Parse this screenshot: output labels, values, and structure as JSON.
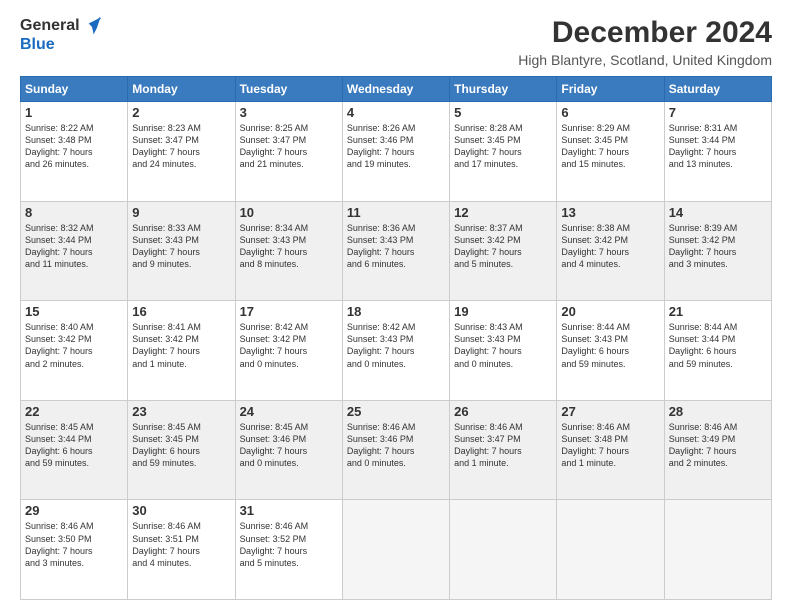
{
  "header": {
    "logo_general": "General",
    "logo_blue": "Blue",
    "title": "December 2024",
    "location": "High Blantyre, Scotland, United Kingdom"
  },
  "columns": [
    "Sunday",
    "Monday",
    "Tuesday",
    "Wednesday",
    "Thursday",
    "Friday",
    "Saturday"
  ],
  "weeks": [
    [
      {
        "day": "1",
        "info": "Sunrise: 8:22 AM\nSunset: 3:48 PM\nDaylight: 7 hours\nand 26 minutes."
      },
      {
        "day": "2",
        "info": "Sunrise: 8:23 AM\nSunset: 3:47 PM\nDaylight: 7 hours\nand 24 minutes."
      },
      {
        "day": "3",
        "info": "Sunrise: 8:25 AM\nSunset: 3:47 PM\nDaylight: 7 hours\nand 21 minutes."
      },
      {
        "day": "4",
        "info": "Sunrise: 8:26 AM\nSunset: 3:46 PM\nDaylight: 7 hours\nand 19 minutes."
      },
      {
        "day": "5",
        "info": "Sunrise: 8:28 AM\nSunset: 3:45 PM\nDaylight: 7 hours\nand 17 minutes."
      },
      {
        "day": "6",
        "info": "Sunrise: 8:29 AM\nSunset: 3:45 PM\nDaylight: 7 hours\nand 15 minutes."
      },
      {
        "day": "7",
        "info": "Sunrise: 8:31 AM\nSunset: 3:44 PM\nDaylight: 7 hours\nand 13 minutes."
      }
    ],
    [
      {
        "day": "8",
        "info": "Sunrise: 8:32 AM\nSunset: 3:44 PM\nDaylight: 7 hours\nand 11 minutes."
      },
      {
        "day": "9",
        "info": "Sunrise: 8:33 AM\nSunset: 3:43 PM\nDaylight: 7 hours\nand 9 minutes."
      },
      {
        "day": "10",
        "info": "Sunrise: 8:34 AM\nSunset: 3:43 PM\nDaylight: 7 hours\nand 8 minutes."
      },
      {
        "day": "11",
        "info": "Sunrise: 8:36 AM\nSunset: 3:43 PM\nDaylight: 7 hours\nand 6 minutes."
      },
      {
        "day": "12",
        "info": "Sunrise: 8:37 AM\nSunset: 3:42 PM\nDaylight: 7 hours\nand 5 minutes."
      },
      {
        "day": "13",
        "info": "Sunrise: 8:38 AM\nSunset: 3:42 PM\nDaylight: 7 hours\nand 4 minutes."
      },
      {
        "day": "14",
        "info": "Sunrise: 8:39 AM\nSunset: 3:42 PM\nDaylight: 7 hours\nand 3 minutes."
      }
    ],
    [
      {
        "day": "15",
        "info": "Sunrise: 8:40 AM\nSunset: 3:42 PM\nDaylight: 7 hours\nand 2 minutes."
      },
      {
        "day": "16",
        "info": "Sunrise: 8:41 AM\nSunset: 3:42 PM\nDaylight: 7 hours\nand 1 minute."
      },
      {
        "day": "17",
        "info": "Sunrise: 8:42 AM\nSunset: 3:42 PM\nDaylight: 7 hours\nand 0 minutes."
      },
      {
        "day": "18",
        "info": "Sunrise: 8:42 AM\nSunset: 3:43 PM\nDaylight: 7 hours\nand 0 minutes."
      },
      {
        "day": "19",
        "info": "Sunrise: 8:43 AM\nSunset: 3:43 PM\nDaylight: 7 hours\nand 0 minutes."
      },
      {
        "day": "20",
        "info": "Sunrise: 8:44 AM\nSunset: 3:43 PM\nDaylight: 6 hours\nand 59 minutes."
      },
      {
        "day": "21",
        "info": "Sunrise: 8:44 AM\nSunset: 3:44 PM\nDaylight: 6 hours\nand 59 minutes."
      }
    ],
    [
      {
        "day": "22",
        "info": "Sunrise: 8:45 AM\nSunset: 3:44 PM\nDaylight: 6 hours\nand 59 minutes."
      },
      {
        "day": "23",
        "info": "Sunrise: 8:45 AM\nSunset: 3:45 PM\nDaylight: 6 hours\nand 59 minutes."
      },
      {
        "day": "24",
        "info": "Sunrise: 8:45 AM\nSunset: 3:46 PM\nDaylight: 7 hours\nand 0 minutes."
      },
      {
        "day": "25",
        "info": "Sunrise: 8:46 AM\nSunset: 3:46 PM\nDaylight: 7 hours\nand 0 minutes."
      },
      {
        "day": "26",
        "info": "Sunrise: 8:46 AM\nSunset: 3:47 PM\nDaylight: 7 hours\nand 1 minute."
      },
      {
        "day": "27",
        "info": "Sunrise: 8:46 AM\nSunset: 3:48 PM\nDaylight: 7 hours\nand 1 minute."
      },
      {
        "day": "28",
        "info": "Sunrise: 8:46 AM\nSunset: 3:49 PM\nDaylight: 7 hours\nand 2 minutes."
      }
    ],
    [
      {
        "day": "29",
        "info": "Sunrise: 8:46 AM\nSunset: 3:50 PM\nDaylight: 7 hours\nand 3 minutes."
      },
      {
        "day": "30",
        "info": "Sunrise: 8:46 AM\nSunset: 3:51 PM\nDaylight: 7 hours\nand 4 minutes."
      },
      {
        "day": "31",
        "info": "Sunrise: 8:46 AM\nSunset: 3:52 PM\nDaylight: 7 hours\nand 5 minutes."
      },
      {
        "day": "",
        "info": ""
      },
      {
        "day": "",
        "info": ""
      },
      {
        "day": "",
        "info": ""
      },
      {
        "day": "",
        "info": ""
      }
    ]
  ]
}
